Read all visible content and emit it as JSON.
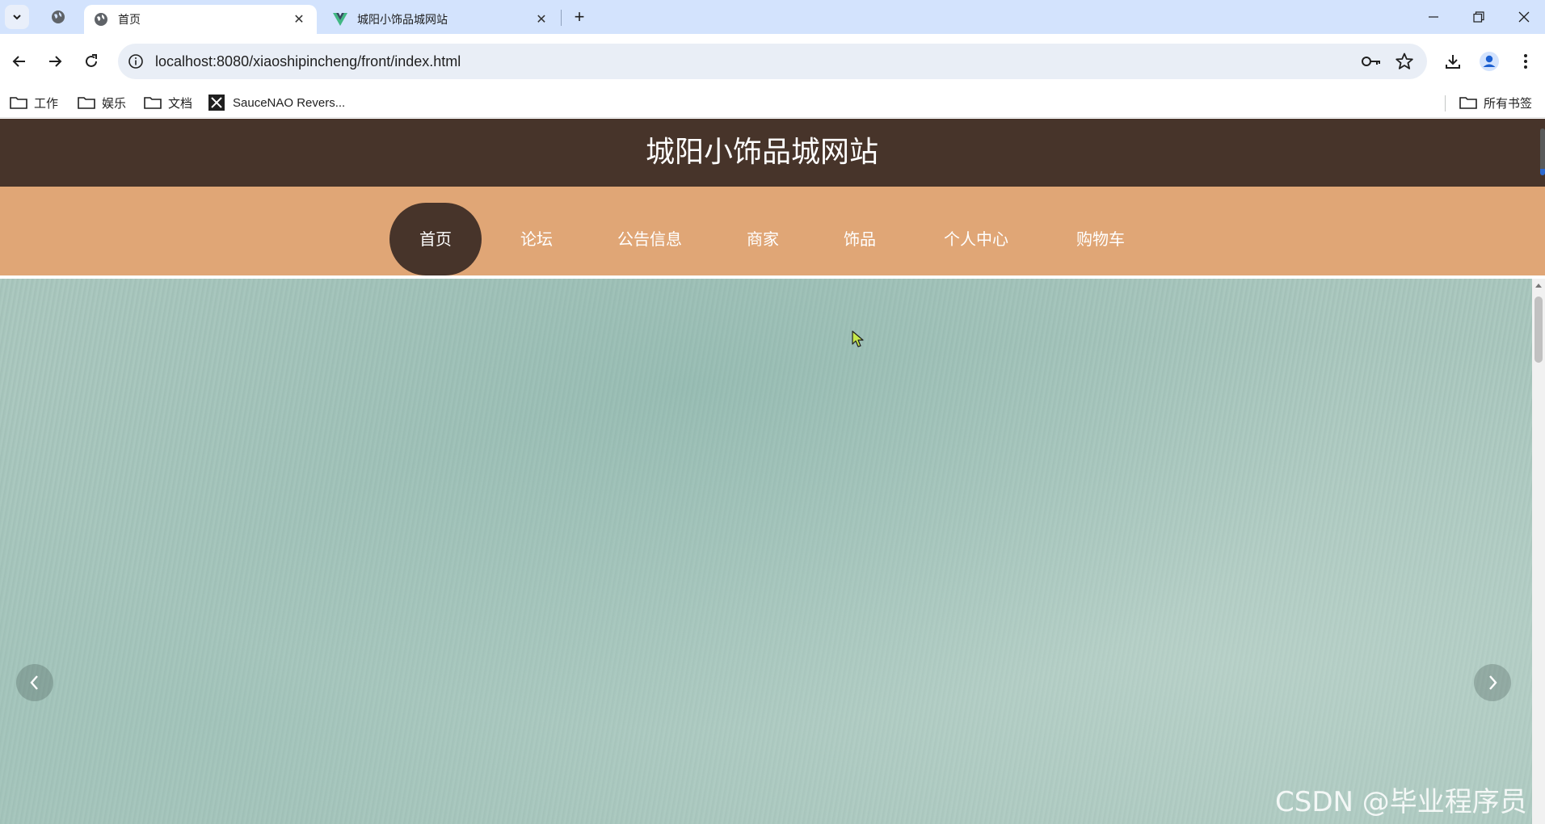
{
  "browser": {
    "tabs": [
      {
        "title": "首页",
        "active": true,
        "icon": "globe-icon"
      },
      {
        "title": "城阳小饰品城网站",
        "active": false,
        "icon": "vue-logo-icon"
      }
    ],
    "url": "localhost:8080/xiaoshipincheng/front/index.html",
    "bookmarks": [
      {
        "label": "工作",
        "icon": "folder-icon"
      },
      {
        "label": "娱乐",
        "icon": "folder-icon"
      },
      {
        "label": "文档",
        "icon": "folder-icon"
      },
      {
        "label": "SauceNAO Revers...",
        "icon": "saucenao-icon"
      }
    ],
    "all_bookmarks": "所有书签"
  },
  "site": {
    "title": "城阳小饰品城网站",
    "nav": [
      {
        "label": "首页",
        "active": true
      },
      {
        "label": "论坛"
      },
      {
        "label": "公告信息"
      },
      {
        "label": "商家"
      },
      {
        "label": "饰品"
      },
      {
        "label": "个人中心"
      },
      {
        "label": "购物车"
      }
    ]
  },
  "watermark": "CSDN @毕业程序员",
  "colors": {
    "tabstrip": "#d3e3fd",
    "header": "#47342a",
    "nav": "#e0a676",
    "banner": "#a8c6bd"
  }
}
